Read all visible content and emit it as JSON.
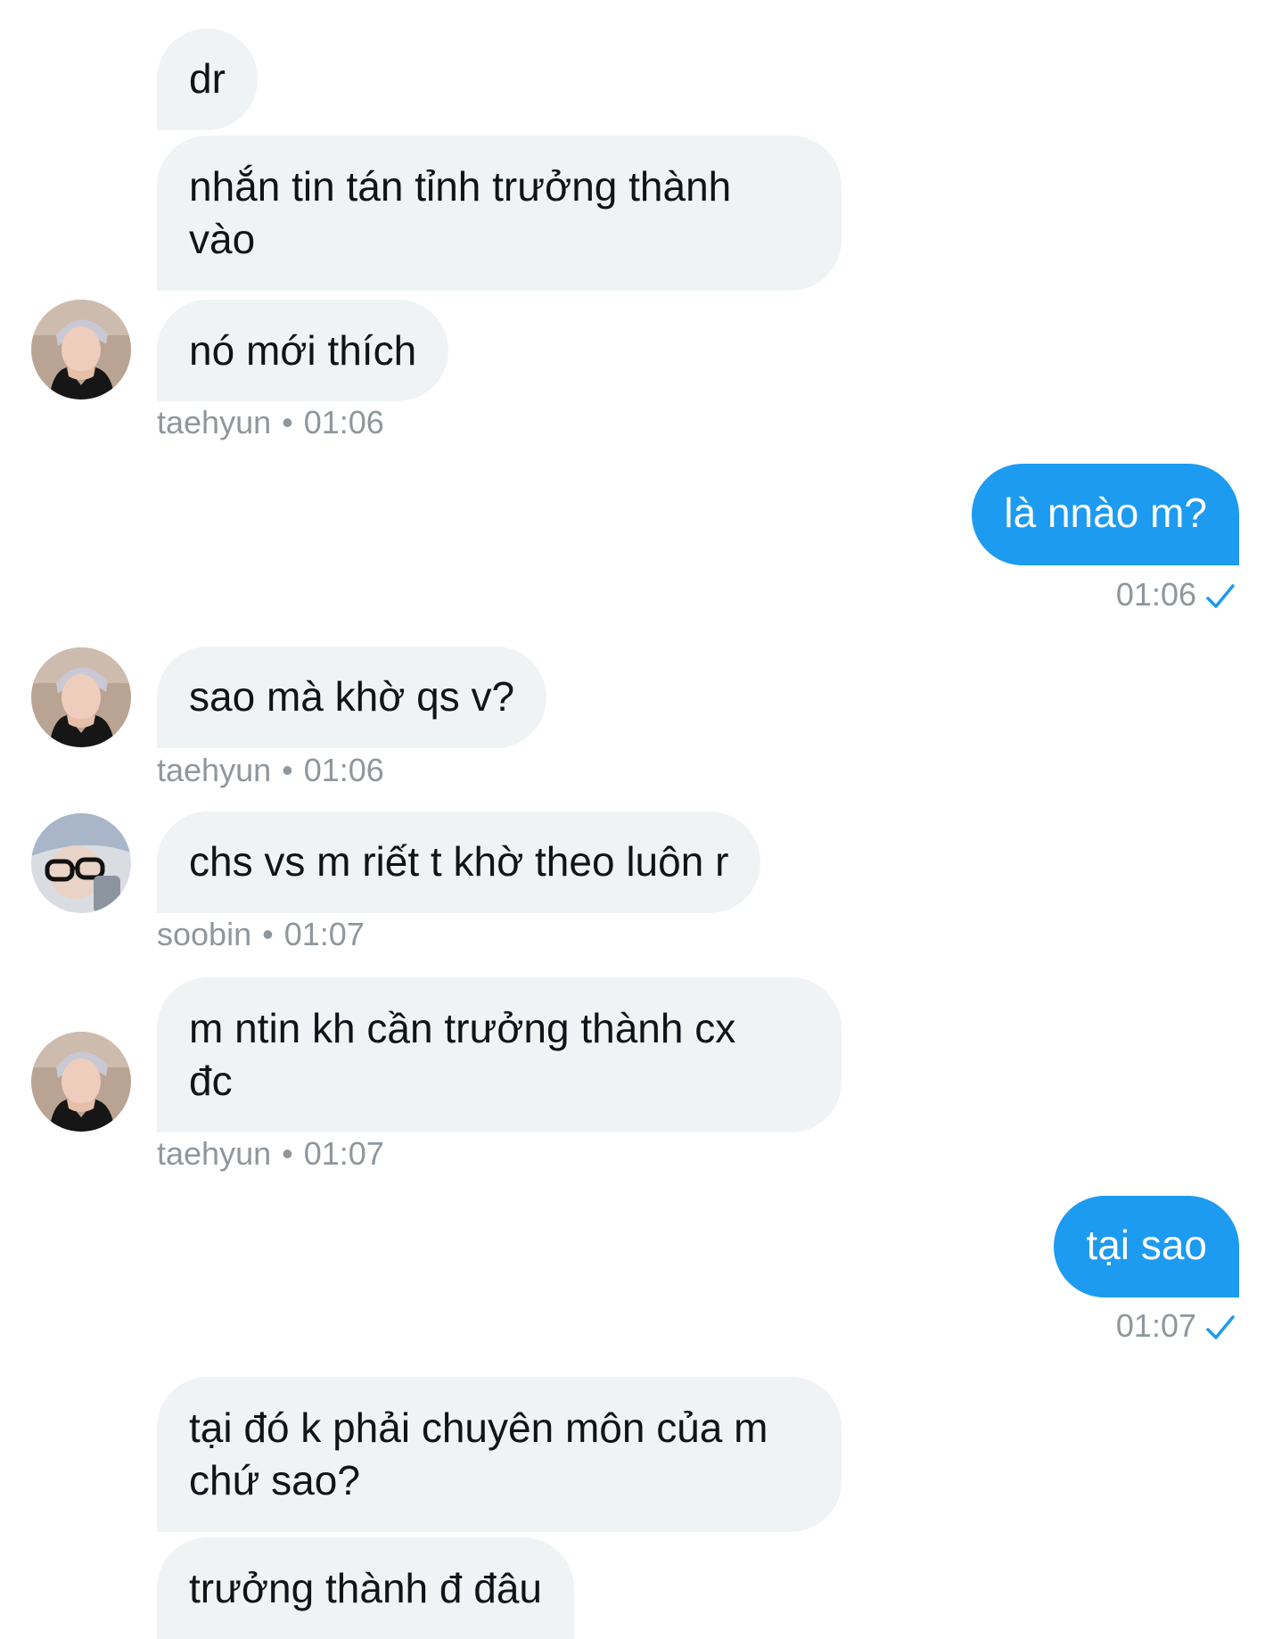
{
  "conversation": {
    "messages": [
      {
        "sender": "taehyun",
        "text": "dr"
      },
      {
        "sender": "taehyun",
        "text": "nhắn tin tán tỉnh trưởng thành\nvào"
      },
      {
        "sender": "taehyun",
        "text": "nó mới thích"
      },
      {
        "sender": "me",
        "text": "là nnào m?"
      },
      {
        "sender": "taehyun",
        "text": "sao mà khờ qs v?"
      },
      {
        "sender": "soobin",
        "text": "chs vs m riết t khờ theo luôn r"
      },
      {
        "sender": "taehyun",
        "text": "m ntin kh cần trưởng thành cx\nđc"
      },
      {
        "sender": "me",
        "text": "tại sao"
      },
      {
        "sender": "taehyun",
        "text": "tại đó k phải chuyên môn của m\nchứ sao?"
      },
      {
        "sender": "taehyun",
        "text": "trưởng thành đ đâu"
      }
    ],
    "meta": [
      {
        "name": "taehyun",
        "sep": "•",
        "time": "01:06"
      },
      {
        "time": "01:06",
        "status": "sent-check-icon"
      },
      {
        "name": "taehyun",
        "sep": "•",
        "time": "01:06"
      },
      {
        "name": "soobin",
        "sep": "•",
        "time": "01:07"
      },
      {
        "name": "taehyun",
        "sep": "•",
        "time": "01:07"
      },
      {
        "time": "01:07",
        "status": "sent-check-icon"
      }
    ]
  },
  "colors": {
    "incoming_bubble": "#eff3f4",
    "outgoing_bubble": "#1d9bf0",
    "meta_text": "#8f979d",
    "check": "#1d9bf0"
  }
}
